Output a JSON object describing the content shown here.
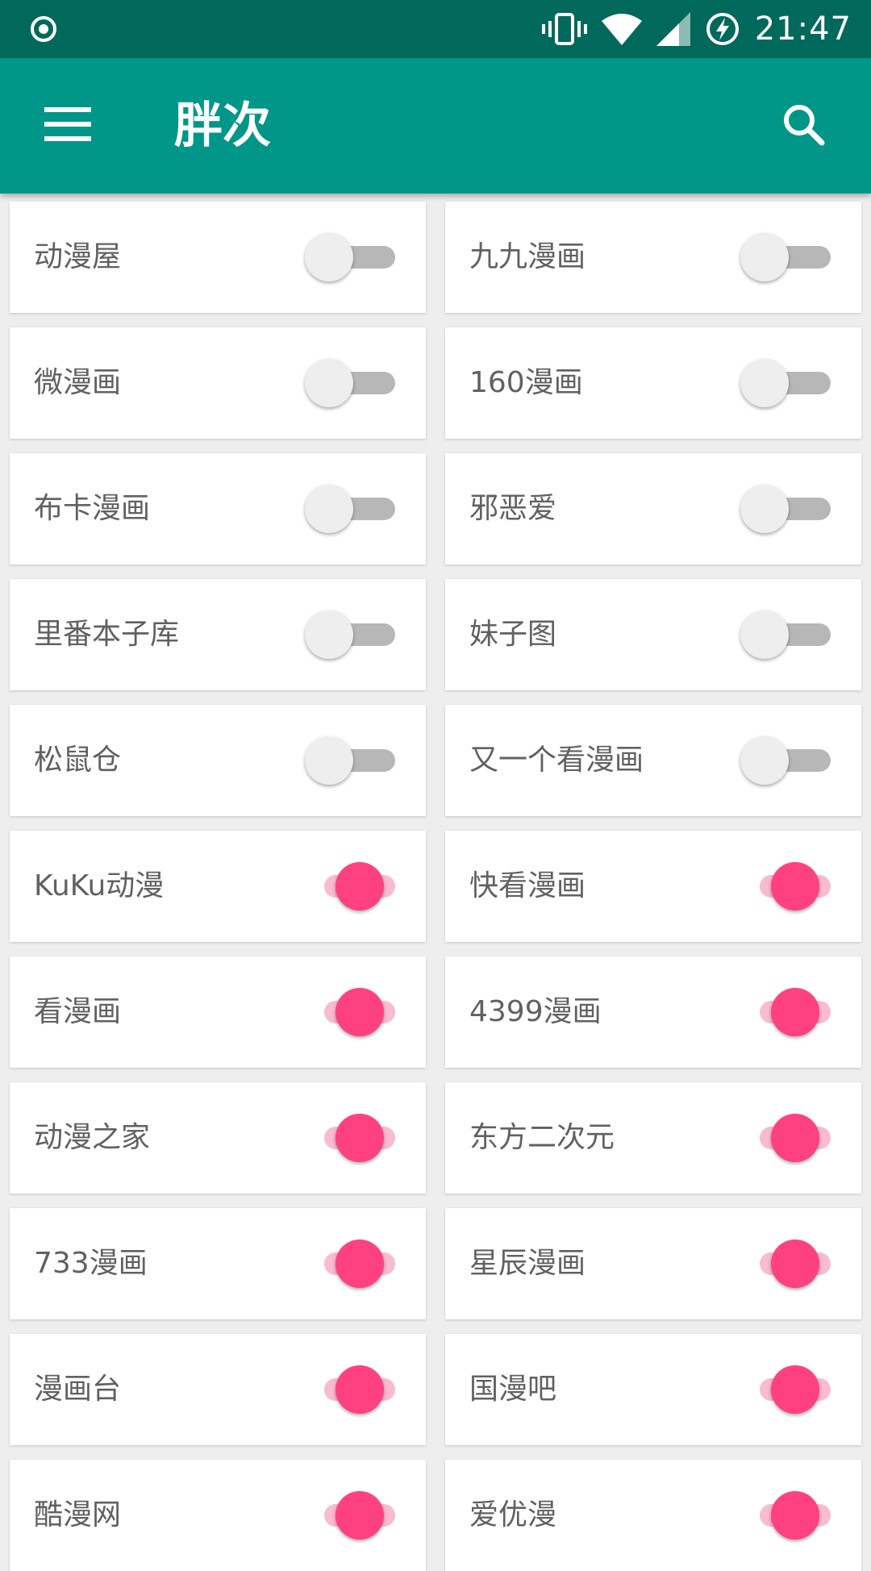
{
  "status_bar": {
    "time": "21:47",
    "icons": [
      "sync-icon",
      "vibrate-icon",
      "wifi-icon",
      "signal-icon",
      "battery-charging-icon"
    ]
  },
  "app_bar": {
    "title": "胖次",
    "menu_icon": "menu-icon",
    "search_icon": "search-icon"
  },
  "colors": {
    "status_bar": "#00695c",
    "app_bar": "#009688",
    "accent": "#ff4081",
    "background": "#eeeeee"
  },
  "sources": [
    {
      "label": "动漫屋",
      "enabled": false
    },
    {
      "label": "九九漫画",
      "enabled": false
    },
    {
      "label": "微漫画",
      "enabled": false
    },
    {
      "label": "160漫画",
      "enabled": false
    },
    {
      "label": "布卡漫画",
      "enabled": false
    },
    {
      "label": "邪恶爱",
      "enabled": false
    },
    {
      "label": "里番本子库",
      "enabled": false
    },
    {
      "label": "妹子图",
      "enabled": false
    },
    {
      "label": "松鼠仓",
      "enabled": false
    },
    {
      "label": "又一个看漫画",
      "enabled": false
    },
    {
      "label": "KuKu动漫",
      "enabled": true
    },
    {
      "label": "快看漫画",
      "enabled": true
    },
    {
      "label": "看漫画",
      "enabled": true
    },
    {
      "label": "4399漫画",
      "enabled": true
    },
    {
      "label": "动漫之家",
      "enabled": true
    },
    {
      "label": "东方二次元",
      "enabled": true
    },
    {
      "label": "733漫画",
      "enabled": true
    },
    {
      "label": "星辰漫画",
      "enabled": true
    },
    {
      "label": "漫画台",
      "enabled": true
    },
    {
      "label": "国漫吧",
      "enabled": true
    },
    {
      "label": "酷漫网",
      "enabled": true
    },
    {
      "label": "爱优漫",
      "enabled": true
    }
  ]
}
